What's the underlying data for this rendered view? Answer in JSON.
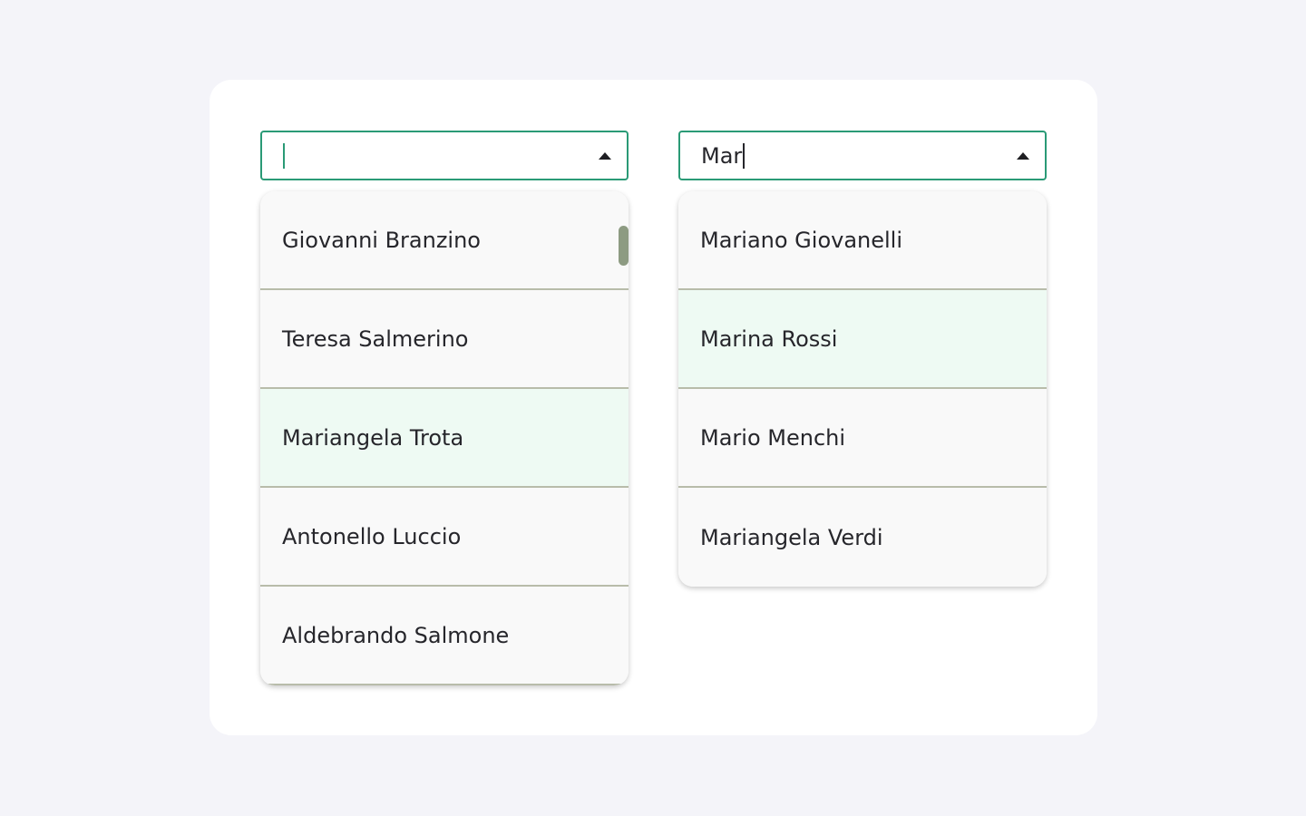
{
  "left_combo": {
    "input_value": "",
    "options": [
      {
        "label": "Giovanni Branzino"
      },
      {
        "label": "Teresa Salmerino"
      },
      {
        "label": "Mariangela Trota"
      },
      {
        "label": "Antonello Luccio"
      },
      {
        "label": "Aldebrando Salmone"
      }
    ],
    "active_index": 2
  },
  "right_combo": {
    "input_value": "Mar",
    "options": [
      {
        "label": "Mariano Giovanelli"
      },
      {
        "label": "Marina Rossi"
      },
      {
        "label": "Mario Menchi"
      },
      {
        "label": "Mariangela Verdi"
      }
    ],
    "active_index": 1
  },
  "colors": {
    "page_background": "#f4f4f9",
    "card_background": "#ffffff",
    "accent_border": "#2a9a76",
    "option_background": "#f9f9f9",
    "option_active_background": "#eefaf3",
    "divider": "#b8bcaa",
    "scroll_thumb": "#8d9b82"
  },
  "icons": {
    "dropdown_toggle": "caret-up-icon"
  }
}
